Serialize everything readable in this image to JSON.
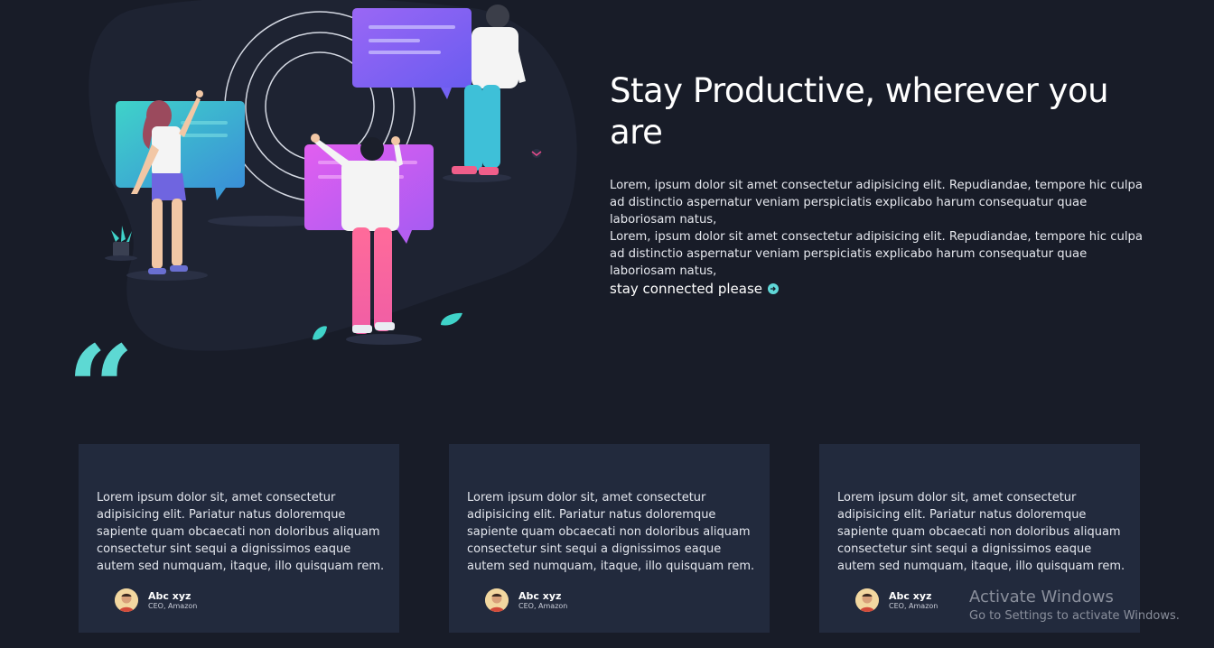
{
  "hero": {
    "title": "Stay Productive, wherever you are",
    "paragraph_1": "Lorem, ipsum dolor sit amet consectetur adipisicing elit. Repudiandae, tempore hic culpa ad distinctio aspernatur veniam perspiciatis explicabo harum consequatur quae laboriosam natus,",
    "paragraph_2": "Lorem, ipsum dolor sit amet consectetur adipisicing elit. Repudiandae, tempore hic culpa ad distinctio aspernatur veniam perspiciatis explicabo harum consequatur quae laboriosam natus,",
    "cta_label": "stay connected please",
    "cta_icon": "arrow-right-circle-icon"
  },
  "illustration": {
    "name": "team-collaboration-illustration"
  },
  "testimonials": {
    "quote_mark": "“",
    "cards": [
      {
        "text": "Lorem ipsum dolor sit, amet consectetur adipisicing elit. Pariatur natus doloremque sapiente quam obcaecati non doloribus aliquam consectetur sint sequi a dignissimos eaque autem sed numquam, itaque, illo quisquam rem.",
        "author_name": "Abc xyz",
        "author_role": "CEO, Amazon"
      },
      {
        "text": "Lorem ipsum dolor sit, amet consectetur adipisicing elit. Pariatur natus doloremque sapiente quam obcaecati non doloribus aliquam consectetur sint sequi a dignissimos eaque autem sed numquam, itaque, illo quisquam rem.",
        "author_name": "Abc xyz",
        "author_role": "CEO, Amazon"
      },
      {
        "text": "Lorem ipsum dolor sit, amet consectetur adipisicing elit. Pariatur natus doloremque sapiente quam obcaecati non doloribus aliquam consectetur sint sequi a dignissimos eaque autem sed numquam, itaque, illo quisquam rem.",
        "author_name": "Abc xyz",
        "author_role": "CEO, Amazon"
      }
    ]
  },
  "watermark": {
    "title": "Activate Windows",
    "subtitle": "Go to Settings to activate Windows."
  },
  "colors": {
    "background": "#181c28",
    "card": "#222a3d",
    "accent": "#5dd9d3"
  }
}
